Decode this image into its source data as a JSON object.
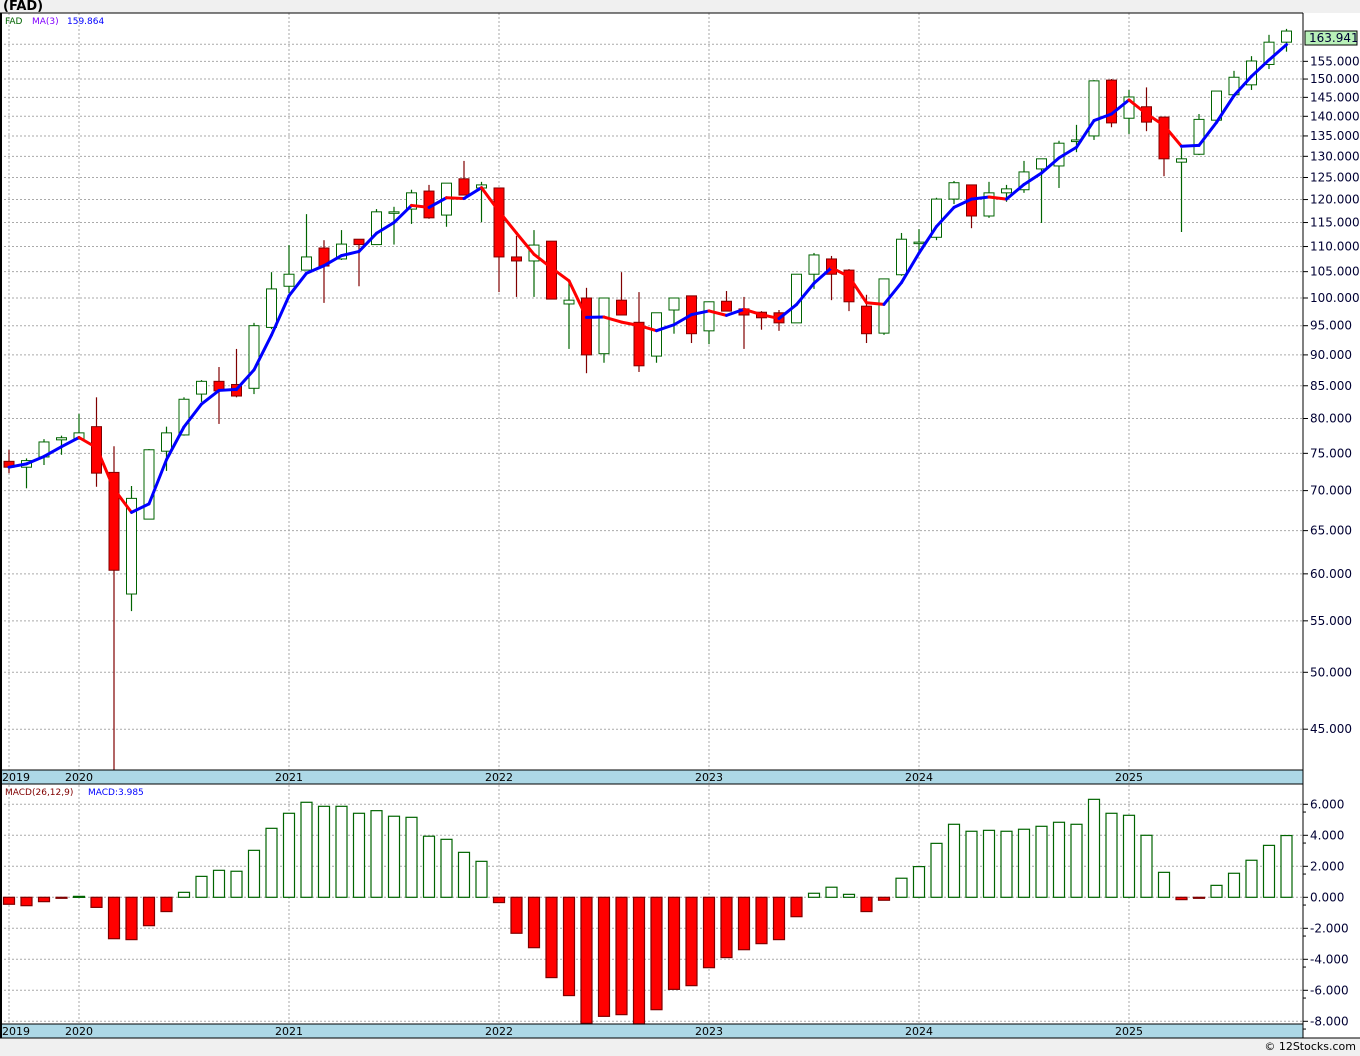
{
  "header": {
    "title": "(FAD)"
  },
  "footer": {
    "copyright": "© 12Stocks.com"
  },
  "legend": {
    "symbol": "FAD",
    "ma_label": "MA(3)",
    "ma_value": "159.864",
    "macd_label": "MACD(26,12,9)",
    "macd_value": "MACD:3.985"
  },
  "last_price": "163.941",
  "colors": {
    "up": "#006400",
    "down": "#ff0000",
    "down_border": "#800000",
    "ma_up": "#0000ff",
    "ma_down": "#ff0000",
    "date_band": "#add8e6",
    "price_box": "#b8f0b8"
  },
  "chart_data": [
    {
      "type": "candlestick",
      "scale": "log",
      "grid": true,
      "overlay": "MA(3)",
      "ylim": [
        41,
        166
      ],
      "y_ticks": [
        "45.000",
        "50.000",
        "55.000",
        "60.000",
        "65.000",
        "70.000",
        "75.000",
        "80.000",
        "85.000",
        "90.000",
        "95.000",
        "100.000",
        "105.000",
        "110.000",
        "115.000",
        "120.000",
        "125.000",
        "130.000",
        "135.000",
        "140.000",
        "145.000",
        "150.000",
        "155.000"
      ],
      "x_ticks": [
        "2019",
        "2020",
        "2021",
        "2022",
        "2023",
        "2024",
        "2025"
      ],
      "dates": [
        "2019-09",
        "2019-10",
        "2019-11",
        "2019-12",
        "2020-01",
        "2020-02",
        "2020-03",
        "2020-04",
        "2020-05",
        "2020-06",
        "2020-07",
        "2020-08",
        "2020-09",
        "2020-10",
        "2020-11",
        "2020-12",
        "2021-01",
        "2021-02",
        "2021-03",
        "2021-04",
        "2021-05",
        "2021-06",
        "2021-07",
        "2021-08",
        "2021-09",
        "2021-10",
        "2021-11",
        "2021-12",
        "2022-01",
        "2022-02",
        "2022-03",
        "2022-04",
        "2022-05",
        "2022-06",
        "2022-07",
        "2022-08",
        "2022-09",
        "2022-10",
        "2022-11",
        "2022-12",
        "2023-01",
        "2023-02",
        "2023-03",
        "2023-04",
        "2023-05",
        "2023-06",
        "2023-07",
        "2023-08",
        "2023-09",
        "2023-10",
        "2023-11",
        "2023-12",
        "2024-01",
        "2024-02",
        "2024-03",
        "2024-04",
        "2024-05",
        "2024-06",
        "2024-07",
        "2024-08",
        "2024-09",
        "2024-10",
        "2024-11",
        "2024-12",
        "2025-01",
        "2025-02",
        "2025-03",
        "2025-04",
        "2025-05",
        "2025-06",
        "2025-07",
        "2025-08",
        "2025-09",
        "2025-10"
      ],
      "open": [
        73.9,
        73.1,
        74.5,
        76.9,
        77.0,
        78.8,
        72.4,
        57.8,
        66.4,
        75.3,
        77.6,
        83.7,
        85.7,
        85.2,
        84.6,
        94.7,
        102.2,
        105.3,
        109.7,
        107.5,
        111.5,
        110.4,
        117.1,
        117.9,
        121.9,
        116.6,
        124.7,
        122.6,
        122.6,
        107.9,
        107.1,
        111.1,
        98.9,
        100.0,
        90.2,
        99.6,
        95.6,
        89.8,
        97.8,
        100.4,
        94.1,
        99.4,
        98.0,
        97.4,
        97.3,
        95.5,
        104.5,
        107.5,
        105.3,
        98.5,
        93.7,
        104.4,
        110.7,
        111.9,
        120.1,
        123.3,
        116.4,
        121.5,
        122.2,
        127.0,
        127.7,
        133.6,
        135.0,
        149.7,
        139.5,
        142.5,
        139.8,
        128.6,
        130.5,
        139.0,
        145.7,
        148.4,
        154.1,
        160.6
      ],
      "high": [
        75.5,
        74.3,
        77.0,
        77.5,
        80.7,
        83.2,
        76.0,
        70.6,
        75.6,
        78.8,
        83.2,
        85.9,
        88.0,
        91.0,
        95.5,
        104.9,
        110.3,
        116.8,
        111.3,
        113.4,
        111.5,
        117.9,
        118.4,
        122.2,
        123.3,
        123.7,
        128.9,
        124.0,
        122.6,
        112.2,
        113.4,
        111.1,
        102.8,
        101.9,
        100.0,
        104.9,
        101.1,
        97.3,
        100.0,
        100.4,
        99.3,
        101.3,
        100.2,
        97.6,
        97.8,
        104.5,
        108.7,
        108.1,
        105.5,
        100.6,
        103.6,
        112.8,
        113.6,
        120.4,
        124.2,
        123.3,
        124.0,
        123.3,
        128.9,
        129.4,
        133.8,
        137.8,
        149.7,
        150.0,
        147.0,
        147.7,
        139.8,
        132.0,
        140.6,
        146.7,
        152.3,
        156.5,
        162.8,
        164.6
      ],
      "low": [
        72.3,
        70.3,
        73.4,
        74.8,
        77.0,
        70.5,
        41.0,
        56.0,
        66.4,
        72.6,
        77.5,
        82.5,
        79.2,
        83.2,
        83.7,
        94.4,
        100.9,
        105.3,
        99.1,
        107.3,
        102.2,
        110.4,
        110.4,
        114.7,
        115.8,
        114.1,
        121.0,
        115.1,
        101.1,
        100.2,
        100.2,
        99.8,
        91.0,
        87.0,
        88.7,
        96.9,
        87.2,
        88.7,
        93.6,
        92.0,
        91.8,
        97.6,
        91.0,
        94.3,
        94.1,
        95.5,
        101.7,
        99.6,
        97.6,
        92.0,
        93.4,
        104.2,
        108.7,
        111.3,
        119.0,
        113.8,
        116.0,
        119.5,
        121.5,
        114.9,
        122.6,
        131.0,
        134.0,
        137.2,
        135.5,
        136.2,
        125.3,
        113.0,
        130.3,
        139.0,
        145.7,
        147.0,
        152.8,
        157.8
      ],
      "close": [
        73.1,
        74.0,
        76.6,
        77.2,
        77.9,
        72.3,
        60.4,
        69.0,
        75.5,
        77.9,
        82.9,
        85.7,
        84.2,
        83.4,
        95.0,
        101.7,
        104.5,
        107.9,
        106.1,
        110.5,
        110.4,
        117.3,
        117.3,
        121.5,
        116.0,
        123.7,
        121.0,
        123.3,
        107.9,
        107.1,
        110.3,
        99.8,
        99.6,
        90.0,
        100.0,
        96.9,
        88.2,
        97.3,
        100.0,
        93.6,
        99.3,
        97.6,
        96.9,
        96.4,
        95.5,
        104.5,
        108.3,
        104.5,
        99.3,
        93.6,
        103.6,
        111.5,
        110.9,
        120.1,
        123.8,
        116.4,
        121.5,
        122.4,
        126.3,
        129.4,
        133.2,
        134.0,
        149.5,
        138.3,
        145.1,
        138.5,
        129.4,
        129.4,
        139.2,
        146.7,
        150.5,
        155.1,
        160.6,
        163.941
      ]
    },
    {
      "type": "bar",
      "title": "MACD(26,12,9)",
      "ylim": [
        -8.3,
        6.5
      ],
      "grid": true,
      "y_ticks": [
        "6.000",
        "4.000",
        "2.000",
        "0.000",
        "-2.000",
        "-4.000",
        "-6.000",
        "-8.000"
      ],
      "x_ticks": [
        "2019",
        "2020",
        "2021",
        "2022",
        "2023",
        "2024",
        "2025"
      ],
      "values": [
        -0.45,
        -0.54,
        -0.28,
        -0.06,
        0.06,
        -0.65,
        -2.67,
        -2.73,
        -1.83,
        -0.92,
        0.32,
        1.35,
        1.74,
        1.68,
        3.03,
        4.45,
        5.42,
        6.13,
        5.87,
        5.87,
        5.42,
        5.59,
        5.23,
        5.16,
        3.94,
        3.74,
        2.9,
        2.32,
        -0.34,
        -2.32,
        -3.25,
        -5.18,
        -6.34,
        -8.13,
        -7.68,
        -7.57,
        -8.3,
        -7.25,
        -5.94,
        -5.7,
        -4.54,
        -3.89,
        -3.38,
        -2.99,
        -2.73,
        -1.25,
        0.26,
        0.65,
        0.19,
        -0.92,
        -0.19,
        1.23,
        1.98,
        3.48,
        4.71,
        4.26,
        4.32,
        4.26,
        4.39,
        4.58,
        4.84,
        4.71,
        6.32,
        5.42,
        5.29,
        4.0,
        1.61,
        -0.15,
        -0.06,
        0.77,
        1.55,
        2.39,
        3.35,
        3.985
      ]
    }
  ]
}
